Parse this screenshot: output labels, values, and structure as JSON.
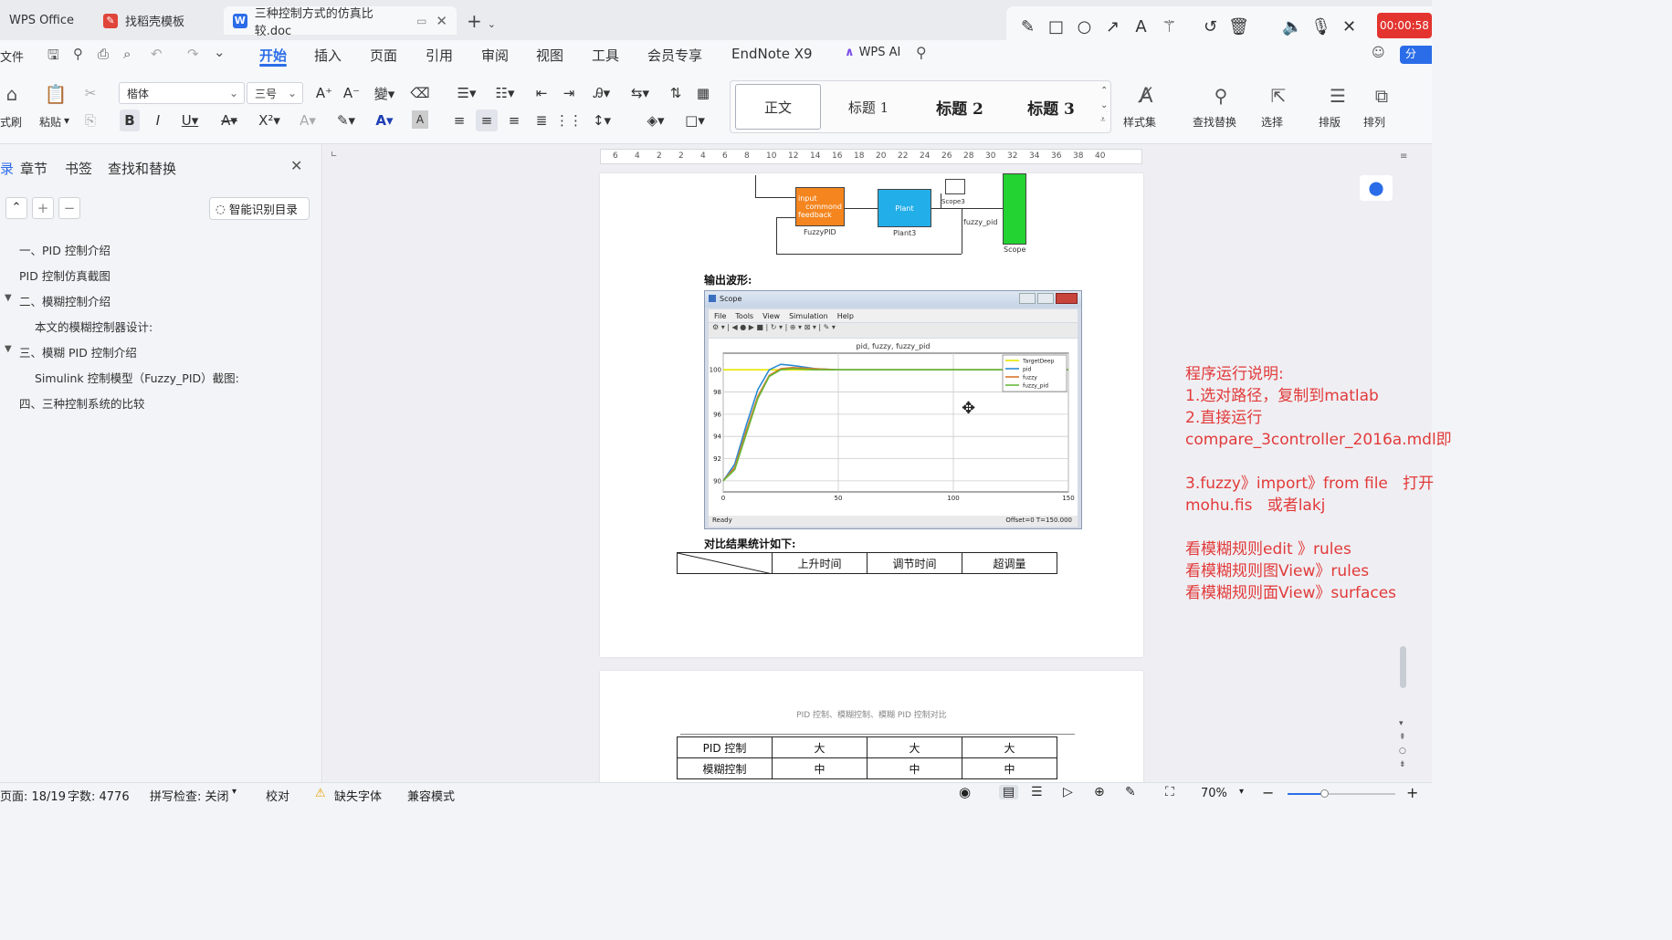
{
  "titlebar": {
    "tabs": [
      {
        "label": "WPS Office"
      },
      {
        "label": "找稻壳模板"
      },
      {
        "label": "三种控制方式的仿真比较.doc"
      }
    ],
    "new_tab": "+",
    "timer": "00:00:58"
  },
  "menu": {
    "file": "文件",
    "items": [
      "开始",
      "插入",
      "页面",
      "引用",
      "审阅",
      "视图",
      "工具",
      "会员专享",
      "EndNote X9"
    ],
    "wps_ai": "WPS AI",
    "active": "开始"
  },
  "ribbon": {
    "format_painter": "式刷",
    "paste": "粘贴",
    "font_name": "楷体",
    "font_size": "三号",
    "styles": [
      "正文",
      "标题 1",
      "标题 2",
      "标题 3"
    ],
    "style_set": "样式集",
    "find_replace": "查找替换",
    "select": "选择",
    "layout": "排版",
    "arrange": "排列"
  },
  "sidebar": {
    "tabs": [
      "章节",
      "书签",
      "查找和替换"
    ],
    "smart_toc": "智能识别目录",
    "outline": [
      {
        "text": "一、PID 控制介绍",
        "level": 1
      },
      {
        "text": "PID 控制仿真截图",
        "level": 1
      },
      {
        "text": "二、模糊控制介绍",
        "level": 1,
        "expanded": true
      },
      {
        "text": "本文的模糊控制器设计:",
        "level": 2
      },
      {
        "text": "三、模糊 PID 控制介绍",
        "level": 1,
        "expanded": true
      },
      {
        "text": "Simulink 控制模型（Fuzzy_PID）截图:",
        "level": 2
      },
      {
        "text": "四、三种控制系统的比较",
        "level": 1
      }
    ]
  },
  "ruler": {
    "ticks": [
      "6",
      "4",
      "2",
      "2",
      "4",
      "6",
      "8",
      "10",
      "12",
      "14",
      "16",
      "18",
      "20",
      "22",
      "24",
      "26",
      "28",
      "30",
      "32",
      "34",
      "36",
      "38",
      "40"
    ]
  },
  "document": {
    "simulink": {
      "fuzzy_block": "FuzzyPID",
      "fuzzy_ports": [
        "input",
        "commond",
        "feedback"
      ],
      "plant_block": "Plant",
      "plant_label": "Plant3",
      "scope3": "Scope3",
      "signal": "fuzzy_pid",
      "scope": "Scope"
    },
    "output_heading": "输出波形:",
    "scope_window": {
      "title": "Scope",
      "menu": [
        "File",
        "Tools",
        "View",
        "Simulation",
        "Help"
      ],
      "plot_title": "pid, fuzzy, fuzzy_pid",
      "status_left": "Ready",
      "status_right": "Offset=0  T=150.000"
    },
    "compare_heading": "对比结果统计如下:",
    "table_header": [
      "上升时间",
      "调节时间",
      "超调量"
    ],
    "page2_caption": "PID 控制、模糊控制、模糊 PID 控制对比",
    "table_rows": [
      {
        "label": "PID 控制",
        "values": [
          "大",
          "大",
          "大"
        ]
      },
      {
        "label": "模糊控制",
        "values": [
          "中",
          "中",
          "中"
        ]
      }
    ]
  },
  "chart_data": {
    "type": "line",
    "title": "pid, fuzzy, fuzzy_pid",
    "xlim": [
      0,
      150
    ],
    "ylim": [
      89,
      101.5
    ],
    "xticks": [
      0,
      50,
      100,
      150
    ],
    "yticks": [
      90,
      92,
      94,
      96,
      98,
      100
    ],
    "legend_position": "top-right",
    "series": [
      {
        "name": "TargetDeep",
        "color": "#e6e600",
        "x": [
          0,
          150
        ],
        "y": [
          100,
          100
        ]
      },
      {
        "name": "pid",
        "color": "#2a8bd4",
        "x": [
          0,
          5,
          10,
          15,
          20,
          25,
          30,
          40,
          50,
          60,
          80,
          100,
          150
        ],
        "y": [
          90,
          91.5,
          95,
          98.2,
          100,
          100.5,
          100.4,
          100.1,
          100,
          100,
          100,
          100,
          100
        ]
      },
      {
        "name": "fuzzy",
        "color": "#d9772b",
        "x": [
          0,
          5,
          10,
          15,
          20,
          25,
          30,
          40,
          50,
          60,
          80,
          100,
          150
        ],
        "y": [
          90,
          91.2,
          94.5,
          97.6,
          99.5,
          100.1,
          100.2,
          100.1,
          100,
          100,
          100,
          100,
          100
        ]
      },
      {
        "name": "fuzzy_pid",
        "color": "#68b83b",
        "x": [
          0,
          5,
          10,
          15,
          20,
          25,
          30,
          40,
          50,
          60,
          80,
          100,
          150
        ],
        "y": [
          90,
          91,
          94.2,
          97.4,
          99.4,
          100,
          100.1,
          100,
          100,
          100,
          100,
          100,
          100
        ]
      }
    ]
  },
  "annotation": {
    "lines": [
      "程序运行说明:",
      "1.选对路径，复制到matlab",
      "2.直接运行",
      "compare_3controller_2016a.mdl即",
      "",
      "3.fuzzy》import》from file   打开",
      "mohu.fis   或者lakj",
      "",
      "看模糊规则edit 》rules",
      "看模糊规则图View》rules",
      "看模糊规则面View》surfaces"
    ]
  },
  "statusbar": {
    "page": "页面: 18/19",
    "words": "字数: 4776",
    "spellcheck": "拼写检查: 关闭",
    "proofread": "校对",
    "missing_font": "缺失字体",
    "compat": "兼容模式",
    "zoom": "70%"
  }
}
